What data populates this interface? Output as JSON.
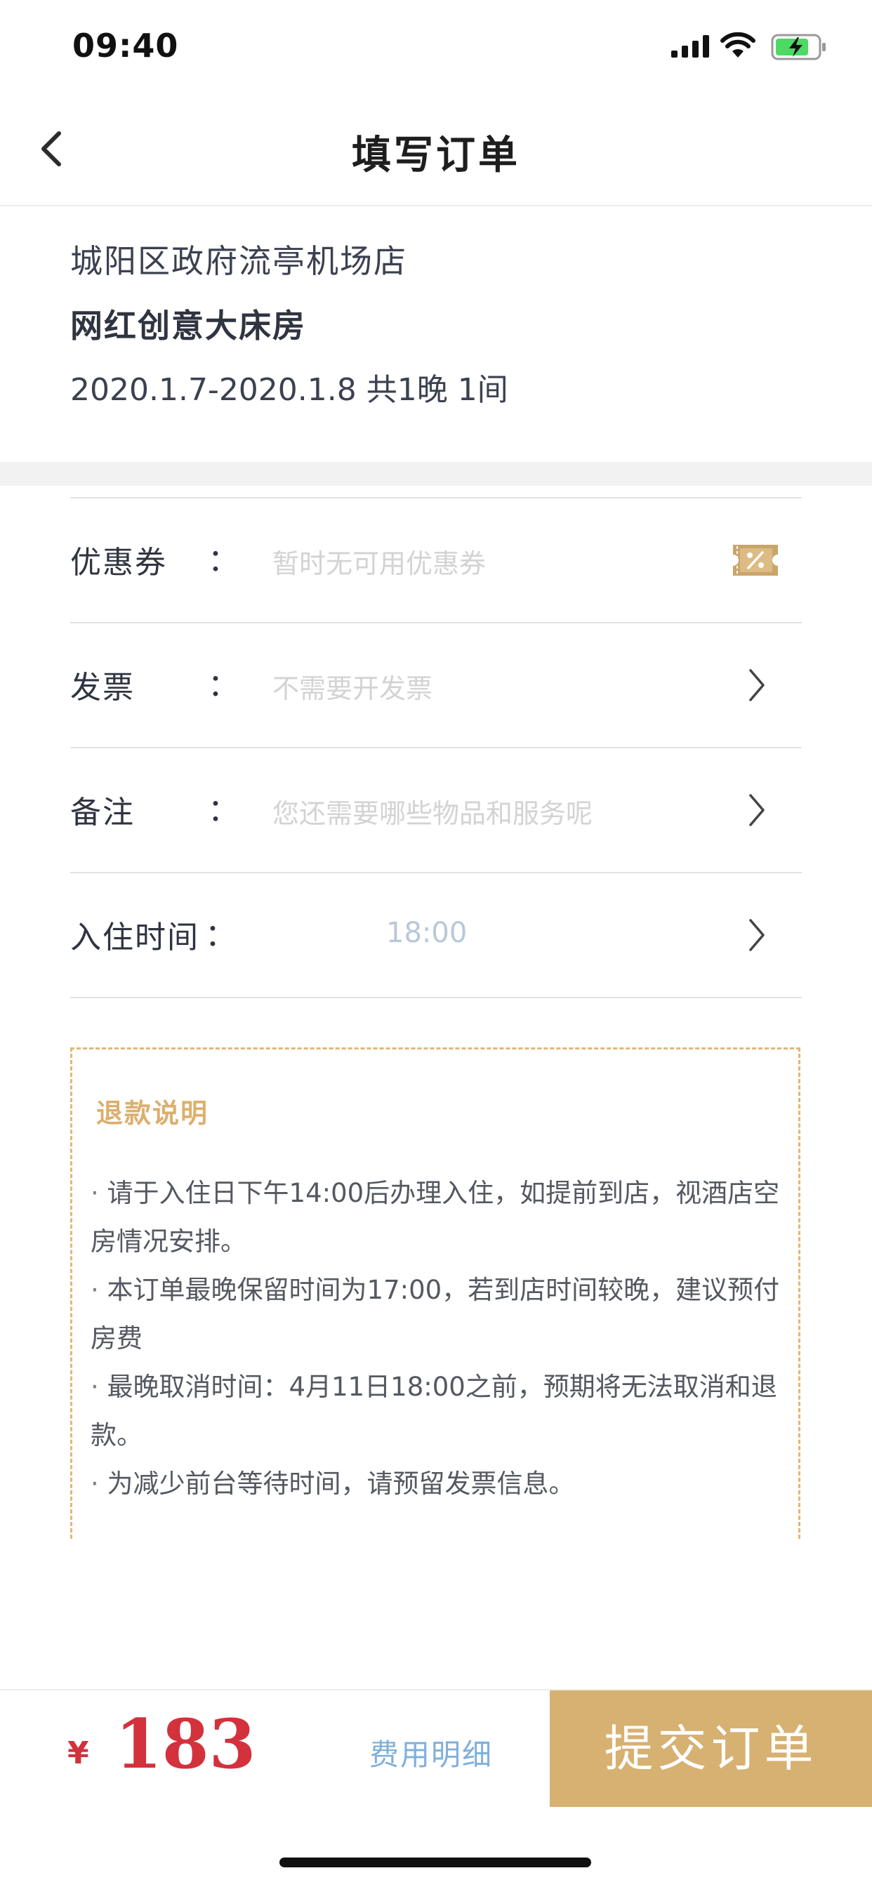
{
  "status_bar": {
    "time": "09:40"
  },
  "nav": {
    "title": "填写订单"
  },
  "hotel": {
    "name": "城阳区政府流亭机场店",
    "room_type": "网红创意大床房",
    "stay": "2020.1.7-2020.1.8 共1晚 1间"
  },
  "form": {
    "coupon": {
      "label": "优惠券",
      "colon": "：",
      "placeholder": "暂时无可用优惠券"
    },
    "invoice": {
      "label": "发票",
      "colon": "：",
      "placeholder": "不需要开发票"
    },
    "remarks": {
      "label": "备注",
      "colon": "：",
      "placeholder": "您还需要哪些物品和服务呢"
    },
    "checkin_time": {
      "label": "入住时间",
      "colon": "：",
      "value": "18:00"
    }
  },
  "refund": {
    "title": "退款说明",
    "items": [
      "请于入住日下午14:00后办理入住，如提前到店，视酒店空房情况安排。",
      "本订单最晚保留时间为17:00，若到店时间较晚，建议预付房费",
      "最晚取消时间：4月11日18:00之前，预期将无法取消和退款。",
      "为减少前台等待时间，请预留发票信息。"
    ]
  },
  "bottom": {
    "currency": "¥",
    "price": "183",
    "fee_detail_label": "费用明细",
    "submit_label": "提交订单"
  },
  "colors": {
    "accent_gold": "#d7b172",
    "price_red": "#d3313c",
    "link_blue": "#7fb0dc"
  }
}
